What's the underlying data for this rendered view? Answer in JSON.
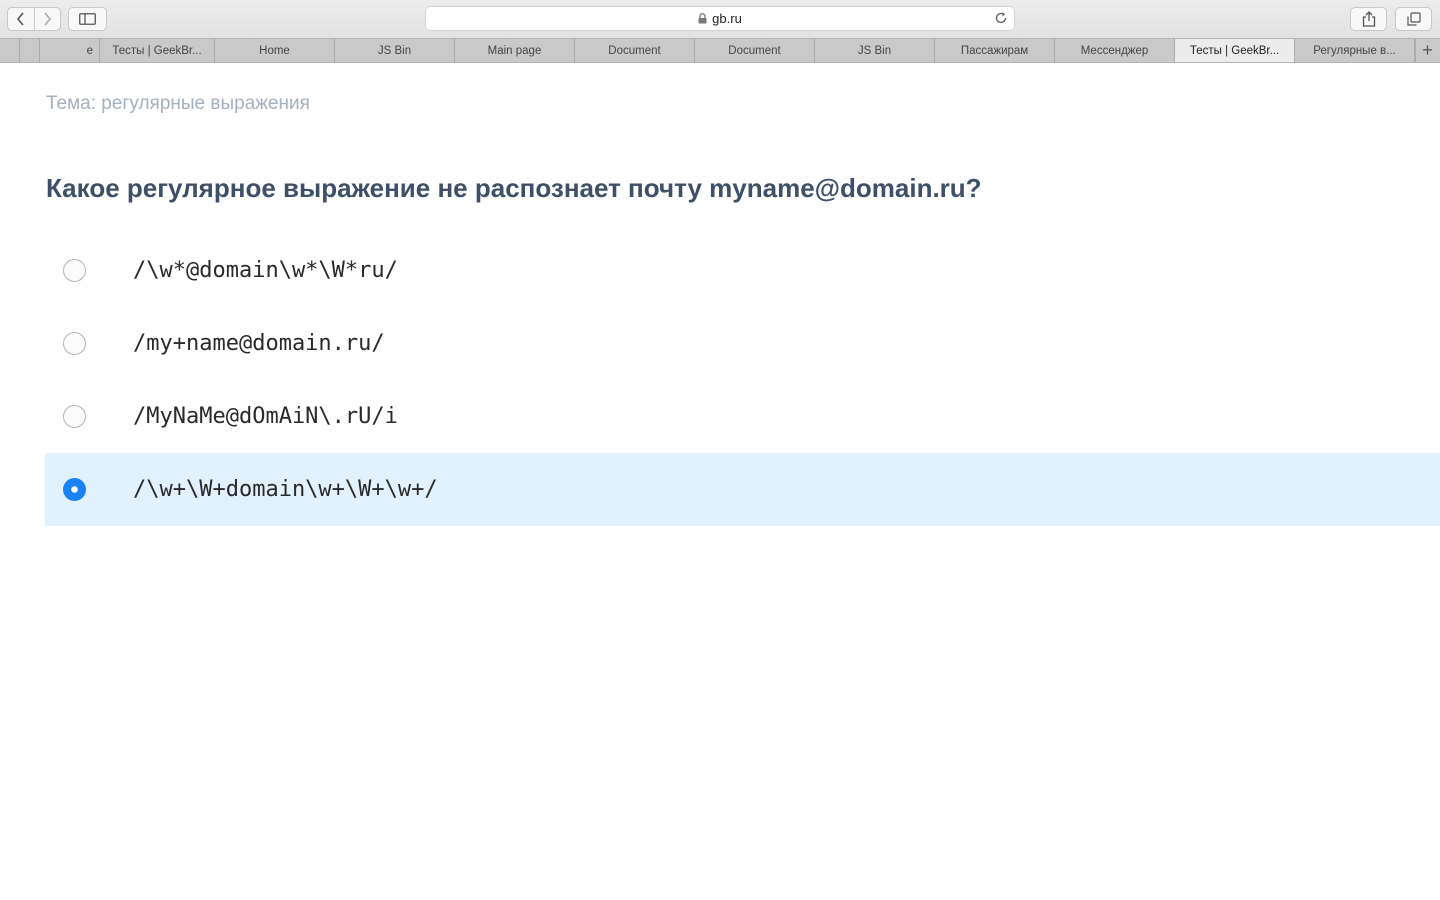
{
  "browser": {
    "url": "gb.ru",
    "tabs": [
      {
        "label": "",
        "size": "tiny"
      },
      {
        "label": "",
        "size": "tiny"
      },
      {
        "label": "е",
        "size": "small"
      },
      {
        "label": "Тесты | GeekBr...",
        "size": "first"
      },
      {
        "label": "Home",
        "size": "reg"
      },
      {
        "label": "JS Bin",
        "size": "reg"
      },
      {
        "label": "Main page",
        "size": "reg"
      },
      {
        "label": "Document",
        "size": "reg"
      },
      {
        "label": "Document",
        "size": "reg"
      },
      {
        "label": "JS Bin",
        "size": "reg"
      },
      {
        "label": "Пассажирам",
        "size": "reg"
      },
      {
        "label": "Мессенджер",
        "size": "reg"
      },
      {
        "label": "Тесты | GeekBr...",
        "size": "reg",
        "active": true
      },
      {
        "label": "Регулярные в...",
        "size": "reg"
      }
    ],
    "new_tab_glyph": "+"
  },
  "quiz": {
    "topic": "Тема: регулярные выражения",
    "question": "Какое регулярное выражение не распознает почту myname@domain.ru?",
    "options": [
      {
        "text": "/\\w*@domain\\w*\\W*ru/",
        "selected": false
      },
      {
        "text": "/my+name@domain.ru/",
        "selected": false
      },
      {
        "text": "/MyNaMe@dOmAiN\\.rU/i",
        "selected": false
      },
      {
        "text": "/\\w+\\W+domain\\w+\\W+\\w+/",
        "selected": true
      }
    ]
  },
  "colors": {
    "topic": "#a4b1be",
    "question": "#3e5068",
    "selected_bg": "#e1f1fd",
    "radio_selected": "#1a82f7"
  },
  "icons": {
    "back": "chevron-left-icon",
    "forward": "chevron-right-icon",
    "sidebar": "sidebar-icon",
    "lock": "lock-icon",
    "reload": "reload-icon",
    "share": "share-icon",
    "tabs_overview": "tabs-overview-icon"
  }
}
